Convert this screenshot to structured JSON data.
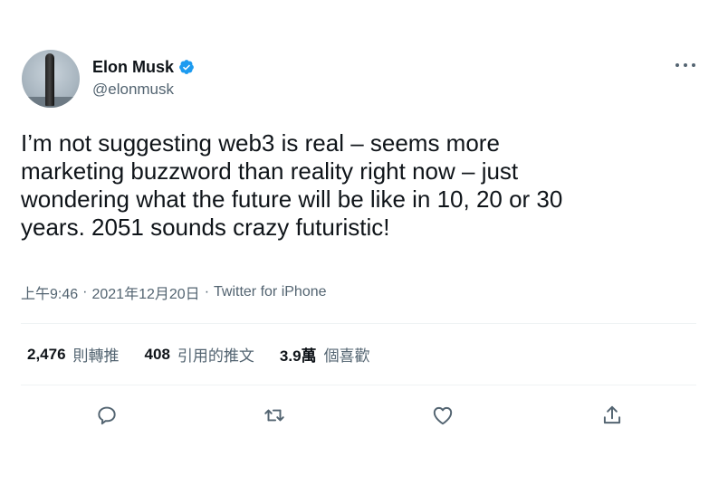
{
  "author": {
    "name": "Elon Musk",
    "handle": "@elonmusk",
    "verified": true,
    "verified_color": "#1d9bf0"
  },
  "tweet": {
    "text": "I’m not suggesting web3 is real – seems more\nmarketing buzzword than reality right now – just\nwondering what the future will be like in 10, 20 or 30\nyears. 2051 sounds crazy futuristic!",
    "time": "上午9:46",
    "date": "2021年12月20日",
    "source": "Twitter for iPhone"
  },
  "stats": {
    "retweets_count": "2,476",
    "retweets_label": "則轉推",
    "quotes_count": "408",
    "quotes_label": "引用的推文",
    "likes_count": "3.9萬",
    "likes_label": "個喜歡"
  },
  "icons": {
    "reply": "reply-icon",
    "retweet": "retweet-icon",
    "like": "heart-icon",
    "share": "share-icon",
    "more": "more-icon"
  }
}
